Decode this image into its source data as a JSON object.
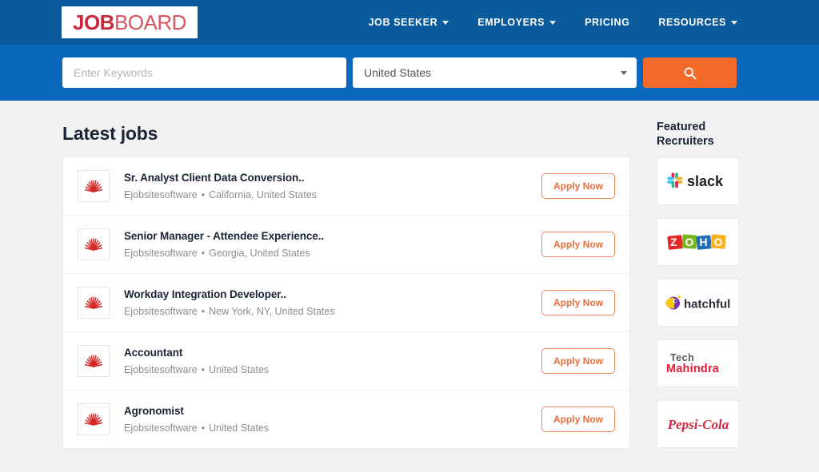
{
  "brand": {
    "part1": "JOB",
    "part2": "BOARD"
  },
  "nav": {
    "items": [
      {
        "label": "JOB SEEKER",
        "has_caret": true
      },
      {
        "label": "EMPLOYERS",
        "has_caret": true
      },
      {
        "label": "PRICING",
        "has_caret": false
      },
      {
        "label": "RESOURCES",
        "has_caret": true
      }
    ]
  },
  "search": {
    "keyword_placeholder": "Enter Keywords",
    "keyword_value": "",
    "location_value": "United States",
    "location_options": [
      "United States"
    ],
    "button_icon": "search-icon"
  },
  "main": {
    "title": "Latest jobs",
    "apply_label": "Apply Now",
    "jobs": [
      {
        "title": "Sr. Analyst Client Data Conversion..",
        "company": "Ejobsitesoftware",
        "location": "California, United States",
        "logo": "red-sunburst-icon"
      },
      {
        "title": "Senior Manager - Attendee Experience..",
        "company": "Ejobsitesoftware",
        "location": "Georgia, United States",
        "logo": "red-sunburst-icon"
      },
      {
        "title": "Workday Integration Developer..",
        "company": "Ejobsitesoftware",
        "location": "New York, NY, United States",
        "logo": "red-sunburst-icon"
      },
      {
        "title": "Accountant",
        "company": "Ejobsitesoftware",
        "location": "United States",
        "logo": "red-sunburst-icon"
      },
      {
        "title": "Agronomist",
        "company": "Ejobsitesoftware",
        "location": "United States",
        "logo": "red-sunburst-icon"
      }
    ]
  },
  "sidebar": {
    "title_line1": "Featured",
    "title_line2": "Recruiters",
    "recruiters": [
      {
        "name": "slack",
        "logo": "slack-logo"
      },
      {
        "name": "ZOHO",
        "logo": "zoho-logo"
      },
      {
        "name": "hatchful",
        "logo": "hatchful-logo"
      },
      {
        "name": "Tech Mahindra",
        "logo": "tech-mahindra-logo"
      },
      {
        "name": "Pepsi-Cola",
        "logo": "pepsi-cola-logo"
      }
    ]
  },
  "colors": {
    "nav_blue": "#0a5a9c",
    "search_blue": "#0a68bc",
    "accent_orange": "#f26a27",
    "apply_orange": "#e8703c",
    "brand_red": "#c9293b",
    "page_bg": "#f2f2f2"
  }
}
